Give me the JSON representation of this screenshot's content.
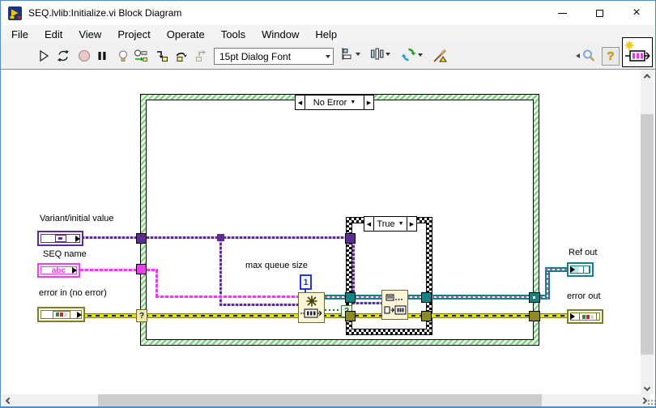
{
  "window": {
    "title": "SEQ.lvlib:Initialize.vi Block Diagram",
    "minimize_glyph": "─",
    "close_glyph": "×"
  },
  "menu": {
    "items": [
      "File",
      "Edit",
      "View",
      "Project",
      "Operate",
      "Tools",
      "Window",
      "Help"
    ]
  },
  "toolbar": {
    "font_selector": "15pt Dialog Font",
    "help_glyph": "?",
    "icons": [
      "run",
      "run-continuously",
      "abort-execution",
      "pause",
      "highlight-execution",
      "retain-wire-values",
      "step-into",
      "step-over",
      "step-out",
      "text-settings",
      "align-objects",
      "distribute-objects",
      "reorder-objects",
      "clean-up-diagram",
      "search",
      "context-help",
      "vi-icon"
    ]
  },
  "diagram": {
    "outer_case": {
      "selector": "No Error"
    },
    "inner_case": {
      "selector": "True"
    },
    "case_nav": {
      "prev": "◀",
      "next": "▶",
      "dropdown": "▼"
    },
    "selector_terminal_glyph": "?",
    "controls": {
      "variant": {
        "label": "Variant/initial value"
      },
      "seq_name": {
        "label": "SEQ name",
        "glyph": "abc"
      },
      "error_in": {
        "label": "error in (no error)"
      }
    },
    "indicators": {
      "ref_out": {
        "label": "Ref out"
      },
      "error_out": {
        "label": "error out"
      }
    },
    "constant": {
      "label": "max queue size",
      "value": "1"
    },
    "nodes": {
      "obtain_queue": "obtain-queue",
      "enqueue_element": "enqueue-element"
    }
  },
  "colors": {
    "variant_purple": "#5E2B93",
    "string_pink": "#F03CF0",
    "error_olive": "#7E7E00",
    "error_yellow": "#E3E300",
    "queue_teal": "#0E8383",
    "numeric_blue": "#2439D2",
    "structure_green": "#7ACB7A",
    "window_border": "#4A90D0"
  }
}
